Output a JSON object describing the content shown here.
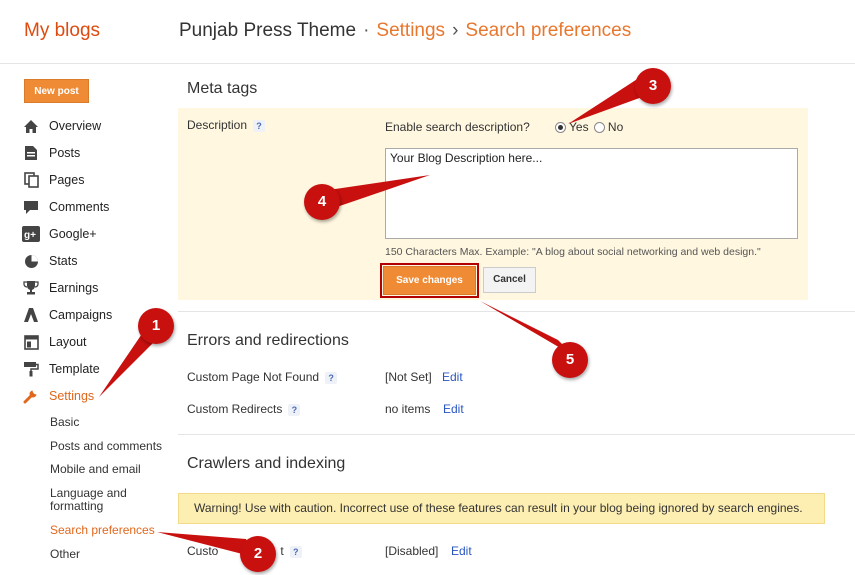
{
  "header": {
    "brand": "My blogs",
    "blog_name": "Punjab Press Theme",
    "separator1": "·",
    "crumb_settings": "Settings",
    "separator2": "›",
    "crumb_search": "Search preferences"
  },
  "sidebar": {
    "new_post": "New post",
    "items": [
      {
        "label": "Overview",
        "icon": "home-icon"
      },
      {
        "label": "Posts",
        "icon": "posts-icon"
      },
      {
        "label": "Pages",
        "icon": "pages-icon"
      },
      {
        "label": "Comments",
        "icon": "comments-icon"
      },
      {
        "label": "Google+",
        "icon": "google-plus-icon"
      },
      {
        "label": "Stats",
        "icon": "stats-icon"
      },
      {
        "label": "Earnings",
        "icon": "trophy-icon"
      },
      {
        "label": "Campaigns",
        "icon": "campaigns-icon"
      },
      {
        "label": "Layout",
        "icon": "layout-icon"
      },
      {
        "label": "Template",
        "icon": "template-icon"
      },
      {
        "label": "Settings",
        "icon": "wrench-icon"
      }
    ],
    "sub_items": [
      "Basic",
      "Posts and comments",
      "Mobile and email",
      "Language and formatting",
      "Search preferences",
      "Other"
    ]
  },
  "meta_tags": {
    "title": "Meta tags",
    "description_label": "Description",
    "help": "?",
    "enable_label": "Enable search description?",
    "yes": "Yes",
    "no": "No",
    "textarea_value": "Your Blog Description here...",
    "hint": "150 Characters Max. Example: \"A blog about social networking and web design.\"",
    "save": "Save changes",
    "cancel": "Cancel"
  },
  "errors": {
    "title": "Errors and redirections",
    "row1_label": "Custom Page Not Found",
    "row1_value": "[Not Set]",
    "row2_label": "Custom Redirects",
    "row2_value": "no items",
    "edit": "Edit"
  },
  "crawlers": {
    "title": "Crawlers and indexing",
    "warning": "Warning! Use with caution. Incorrect use of these features can result in your blog being ignored by search engines.",
    "row_label_visible_left": "Custo",
    "row_label_visible_right": "t",
    "row_value": "[Disabled]",
    "edit": "Edit"
  },
  "markers": [
    "1",
    "2",
    "3",
    "4",
    "5"
  ],
  "colors": {
    "accent": "#e0671d",
    "button": "#f08b35",
    "marker": "#c8100f",
    "link": "#2a55c0",
    "panel": "#fff7e0",
    "warning": "#fdeeb2"
  }
}
